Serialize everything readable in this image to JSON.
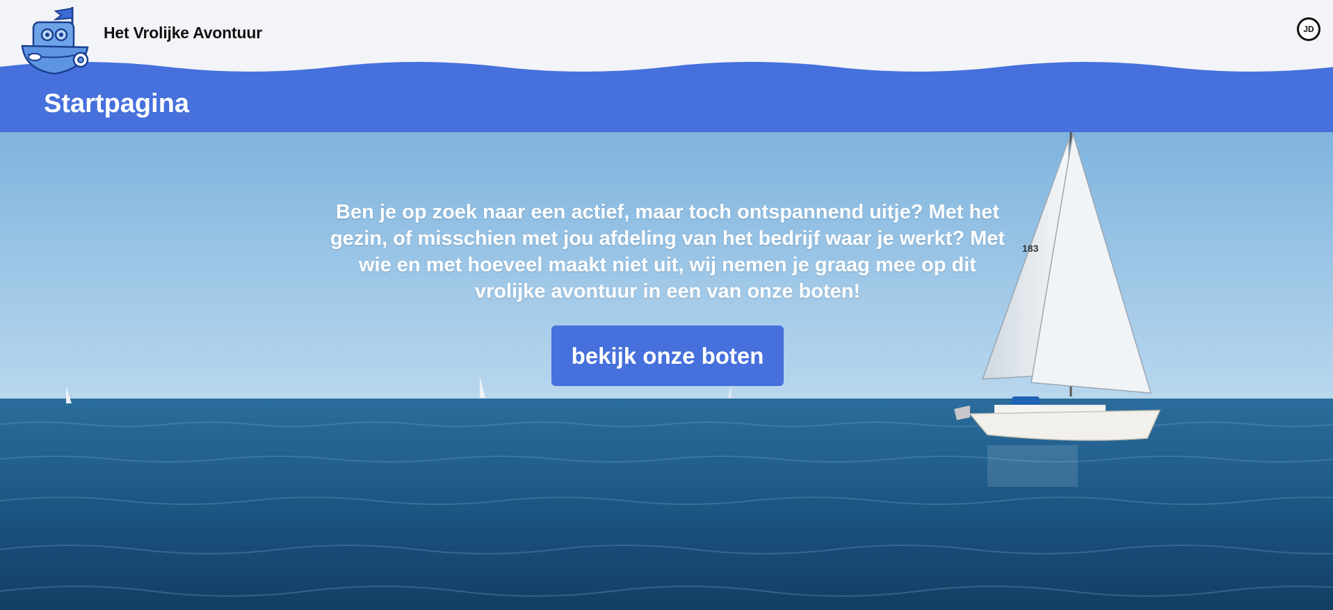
{
  "header": {
    "site_title": "Het Vrolijke Avontuur",
    "avatar_initials": "JD",
    "logo_icon": "boat-mascot-icon"
  },
  "banner": {
    "page_title": "Startpagina"
  },
  "hero": {
    "text": "Ben je op zoek naar een actief, maar toch ontspannend uitje? Met het gezin, of misschien met jou afdeling van het bedrijf waar je werkt? Met wie en met hoeveel maakt niet uit, wij nemen je graag mee op dit vrolijke avontuur in een van onze boten!",
    "cta_label": "bekijk onze boten",
    "sail_number": "183"
  },
  "colors": {
    "accent": "#4670db",
    "page_background": "#f3f4f8",
    "sky": "#86b9e0",
    "sea": "#1c5784"
  }
}
